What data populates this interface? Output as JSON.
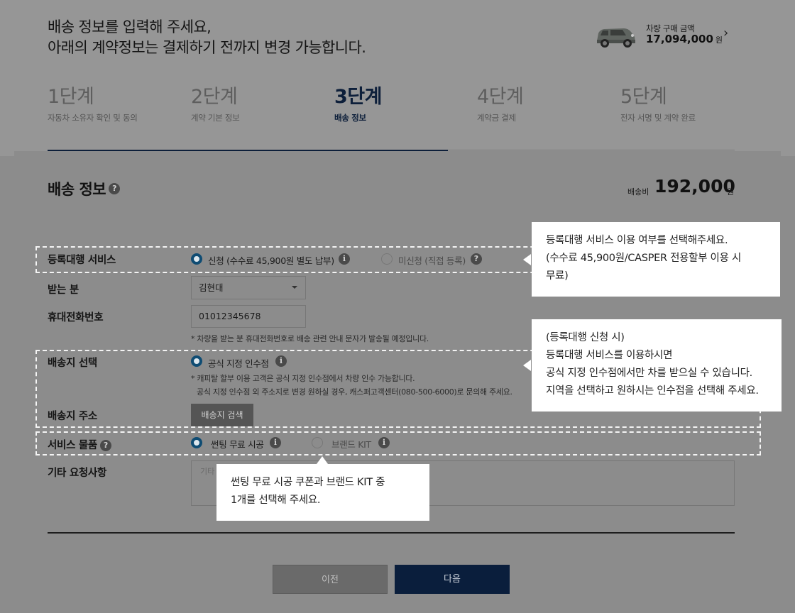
{
  "header": {
    "headline_line1": "배송 정보를 입력해 주세요,",
    "headline_line2": "아래의 계약정보는 결제하기 전까지 변경 가능합니다.",
    "price_label": "차량 구매 금액",
    "price_amount": "17,094,000",
    "price_unit": "원"
  },
  "steps": [
    {
      "num": "1단계",
      "label": "자동차 소유자 확인 및 동의"
    },
    {
      "num": "2단계",
      "label": "계약 기본 정보"
    },
    {
      "num": "3단계",
      "label": "배송 정보"
    },
    {
      "num": "4단계",
      "label": "계약금 결제"
    },
    {
      "num": "5단계",
      "label": "전자 서명 및 계약 완료"
    }
  ],
  "active_step": 3,
  "section": {
    "title": "배송 정보",
    "fee_label": "배송비",
    "fee_value": "192,000",
    "fee_unit": "원"
  },
  "form": {
    "registration": {
      "label": "등록대행 서비스",
      "option_apply": "신청 (수수료 45,900원 별도 납부)",
      "option_decline": "미신청 (직접 등록)",
      "selected": "apply"
    },
    "recipient": {
      "label": "받는 분",
      "value": "김현대"
    },
    "phone": {
      "label": "휴대전화번호",
      "value": "01012345678",
      "note": "* 차량을 받는 분 휴대전화번호로 배송 관련 안내 문자가 발송될 예정입니다."
    },
    "delivery_select": {
      "label": "배송지 선택",
      "option": "공식 지정 인수점",
      "note1": "* 캐피탈 할부 이용 고객은 공식 지정 인수점에서 차량 인수 가능합니다.",
      "note2": "공식 지정 인수점 외 주소지로 변경 원하실 경우, 캐스퍼고객센터(080-500-6000)로 문의해 주세요."
    },
    "delivery_address": {
      "label": "배송지 주소",
      "button": "배송지 검색"
    },
    "service_item": {
      "label": "서비스 물품",
      "option1": "썬팅 무료 시공",
      "option2": "브랜드 KIT",
      "selected": "option1"
    },
    "etc": {
      "label": "기타 요청사항",
      "placeholder": "기타"
    }
  },
  "buttons": {
    "prev": "이전",
    "next": "다음"
  },
  "tooltips": {
    "registration": [
      "등록대행 서비스 이용 여부를 선택해주세요.",
      "(수수료 45,900원/CASPER 전용할부 이용 시",
      "무료)"
    ],
    "delivery": [
      "(등록대행 신청 시)",
      "등록대행 서비스를 이용하시면",
      "공식 지정 인수점에서만 차를 받으실 수 있습니다.",
      "지역을 선택하고 원하시는 인수점을 선택해 주세요."
    ],
    "service": [
      "썬팅 무료 시공 쿠폰과 브랜드 KIT 중",
      "1개를 선택해 주세요."
    ]
  },
  "colors": {
    "overlay_bg": "#8c8c8c",
    "accent_navy": "#0a1e3c",
    "radio_blue": "#0f4c73",
    "tooltip_bg": "#ffffff"
  }
}
